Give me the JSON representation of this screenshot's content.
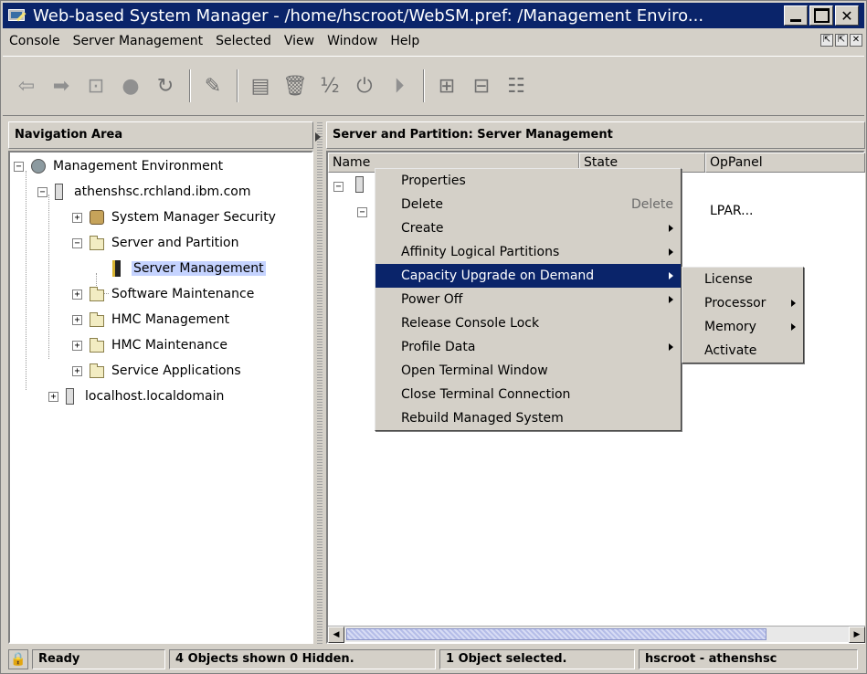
{
  "window": {
    "title": "Web-based System Manager - /home/hscroot/WebSM.pref: /Management Enviro..."
  },
  "menubar": {
    "items": [
      "Console",
      "Server Management",
      "Selected",
      "View",
      "Window",
      "Help"
    ]
  },
  "toolbar": {
    "buttons": [
      "back-arrow-icon",
      "forward-arrow-icon",
      "up-folder-icon",
      "stop-icon",
      "refresh-icon",
      "find-icon",
      "properties-icon",
      "delete-icon",
      "cut-icon",
      "power-icon",
      "run-icon",
      "view-large-icon",
      "view-small-icon",
      "view-details-icon"
    ]
  },
  "navigation": {
    "header": "Navigation Area",
    "tree": {
      "root": "Management Environment",
      "host1": "athenshsc.rchland.ibm.com",
      "items": {
        "system_manager_security": "System Manager Security",
        "server_and_partition": "Server and Partition",
        "server_management": "Server Management",
        "software_maintenance": "Software Maintenance",
        "hmc_management": "HMC Management",
        "hmc_maintenance": "HMC Maintenance",
        "service_applications": "Service Applications"
      },
      "host2": "localhost.localdomain"
    }
  },
  "content": {
    "header": "Server and Partition: Server Management",
    "columns": [
      "Name",
      "State",
      "OpPanel"
    ],
    "row_oppanel": "LPAR..."
  },
  "context_menu": {
    "items": [
      {
        "label": "Properties",
        "shortcut": "",
        "submenu": false
      },
      {
        "label": "Delete",
        "shortcut": "Delete",
        "submenu": false
      },
      {
        "label": "Create",
        "shortcut": "",
        "submenu": true
      },
      {
        "label": "Affinity Logical Partitions",
        "shortcut": "",
        "submenu": true
      },
      {
        "label": "Capacity Upgrade on Demand",
        "shortcut": "",
        "submenu": true,
        "active": true
      },
      {
        "label": "Power Off",
        "shortcut": "",
        "submenu": true
      },
      {
        "label": "Release Console Lock",
        "shortcut": "",
        "submenu": false
      },
      {
        "label": "Profile Data",
        "shortcut": "",
        "submenu": true
      },
      {
        "label": "Open Terminal Window",
        "shortcut": "",
        "submenu": false
      },
      {
        "label": "Close Terminal Connection",
        "shortcut": "",
        "submenu": false
      },
      {
        "label": "Rebuild Managed System",
        "shortcut": "",
        "submenu": false
      }
    ]
  },
  "submenu": {
    "items": [
      {
        "label": "License",
        "submenu": false
      },
      {
        "label": "Processor",
        "submenu": true
      },
      {
        "label": "Memory",
        "submenu": true
      },
      {
        "label": "Activate",
        "submenu": false
      }
    ]
  },
  "statusbar": {
    "ready": "Ready",
    "objects": "4 Objects shown 0 Hidden.",
    "selected": "1 Object selected.",
    "user": "hscroot - athenshsc"
  }
}
